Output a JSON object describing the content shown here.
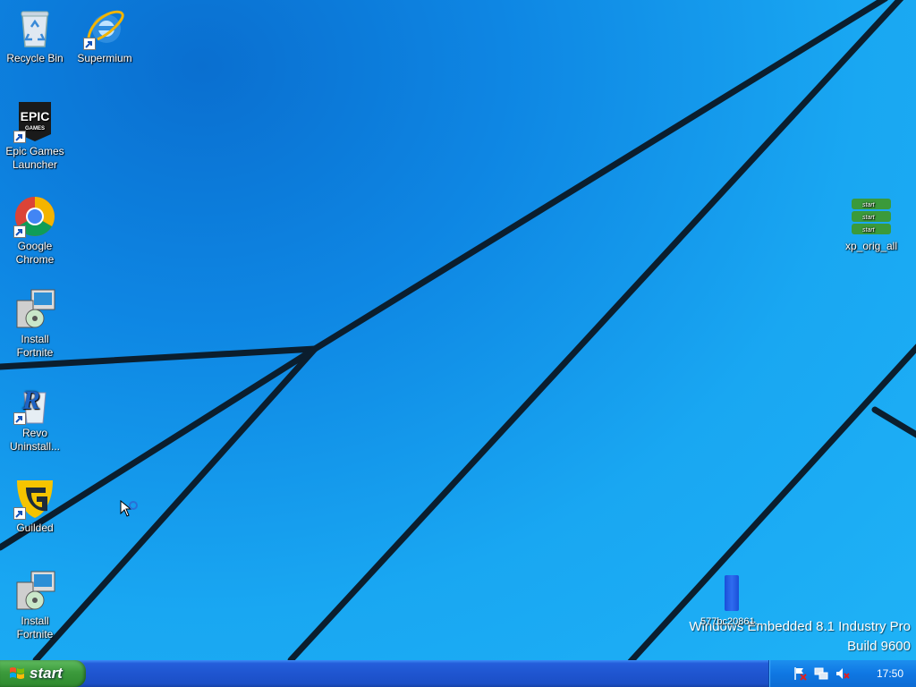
{
  "desktop": {
    "icons": [
      {
        "label": "Recycle Bin",
        "icon": "recycle-bin-icon",
        "shortcut": false
      },
      {
        "label": "Supermium",
        "icon": "supermium-browser-icon",
        "shortcut": true
      },
      {
        "label": "Epic Games\nLauncher",
        "icon": "epic-games-icon",
        "shortcut": true
      },
      {
        "label": "Google\nChrome",
        "icon": "chrome-icon",
        "shortcut": true
      },
      {
        "label": "Install\nFortnite",
        "icon": "installer-icon",
        "shortcut": false
      },
      {
        "label": "Revo\nUninstall...",
        "icon": "revo-uninstaller-icon",
        "shortcut": true
      },
      {
        "label": "Guilded",
        "icon": "guilded-icon",
        "shortcut": true
      },
      {
        "label": "Install\nFortnite",
        "icon": "installer-icon",
        "shortcut": false
      },
      {
        "label": "xp_orig_all",
        "icon": "start-buttons-image-icon",
        "shortcut": false
      },
      {
        "label": "577bc20861...",
        "icon": "blue-file-icon",
        "shortcut": false
      }
    ],
    "watermark": {
      "line1": "Windows Embedded 8.1 Industry Pro",
      "line2": "Build 9600"
    },
    "colors": {
      "wallpaper": "#1fb2f6",
      "lines": "#0b1e2e"
    }
  },
  "taskbar": {
    "start_label": "start",
    "clock": "17:50",
    "tray_icons": [
      "action-center-flag-icon",
      "network-icon",
      "volume-muted-icon"
    ],
    "colors": {
      "bar": "#245edb",
      "start": "#3c9a3c",
      "tray": "#0f77e3"
    }
  },
  "xp_orig_all_thumb": {
    "start_text": "start"
  }
}
